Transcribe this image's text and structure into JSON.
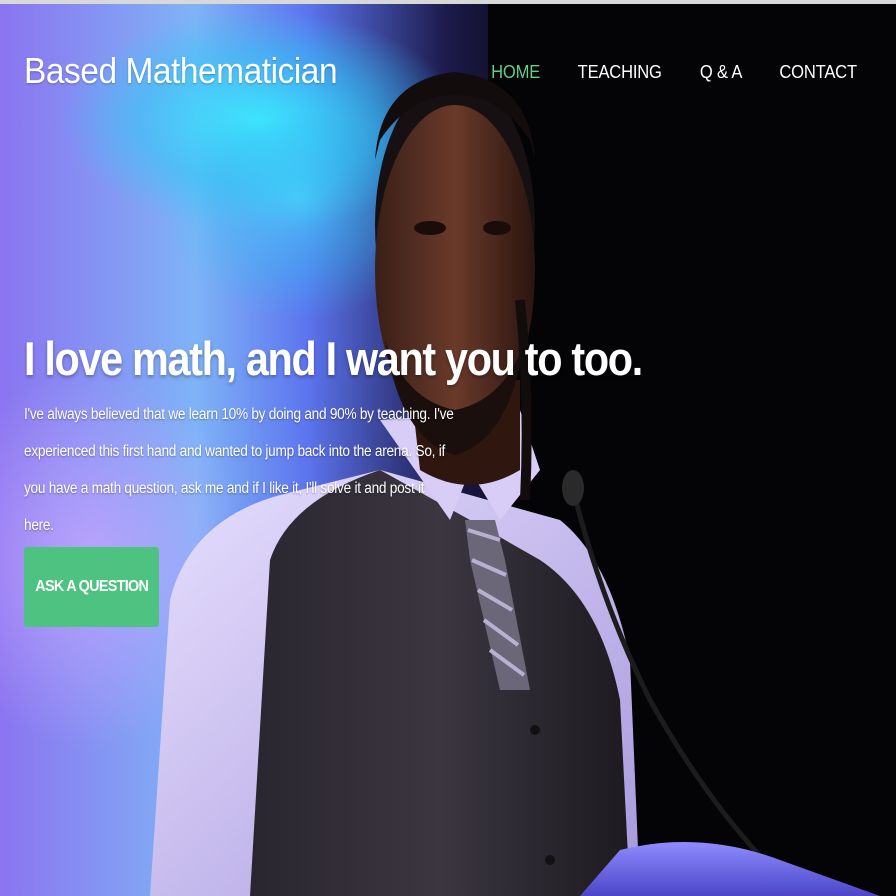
{
  "site": {
    "brand": "Based Mathematician"
  },
  "nav": {
    "items": [
      {
        "label": "HOME",
        "active": true
      },
      {
        "label": "TEACHING",
        "active": false
      },
      {
        "label": "Q & A",
        "active": false
      },
      {
        "label": "CONTACT",
        "active": false
      }
    ]
  },
  "hero": {
    "headline": "I love math, and I want you to too.",
    "intro": "I've always believed that we learn 10% by doing and 90% by teaching. I've experienced this first hand and wanted to jump back into the arena. So, if you have a math question, ask me and if I like it, I'll solve it and post it here.",
    "cta_label": "ASK A QUESTION",
    "photo": "speaker-at-podium-photo"
  },
  "colors": {
    "accent": "#4ec381",
    "nav_active": "#5fd08a",
    "text": "#ffffff"
  }
}
